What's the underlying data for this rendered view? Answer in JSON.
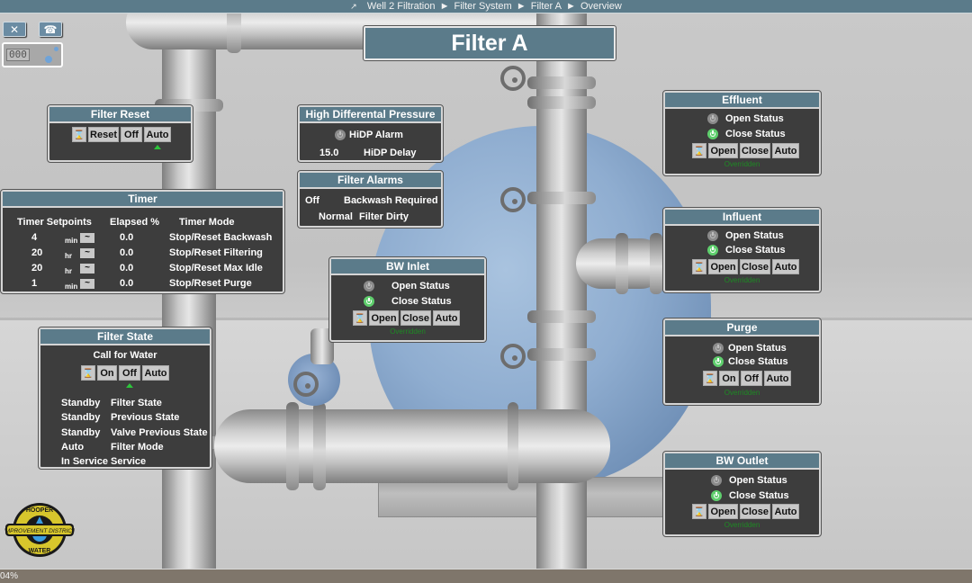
{
  "breadcrumb": {
    "icon": "↗",
    "items": [
      "Well 2 Filtration",
      "Filter System",
      "Filter A",
      "Overview"
    ],
    "separator": "►"
  },
  "toolbar": {
    "tool1_icon": "close-x-icon",
    "tool2_icon": "operator-icon",
    "counter_digits": "000"
  },
  "title": "Filter A",
  "filter_reset": {
    "title": "Filter Reset",
    "buttons": [
      "⌛",
      "Reset",
      "Off",
      "Auto"
    ],
    "selected": "Auto"
  },
  "high_dp": {
    "title": "High Differental Pressure",
    "alarm_label": "HiDP Alarm",
    "alarm_state": "off",
    "delay_value": "15.0",
    "delay_label": "HiDP Delay"
  },
  "filter_alarms": {
    "title": "Filter Alarms",
    "rows": [
      {
        "value": "Off",
        "label": "Backwash Required"
      },
      {
        "value": "Normal",
        "label": "Filter Dirty"
      }
    ]
  },
  "timer": {
    "title": "Timer",
    "headers": [
      "Timer Setpoints",
      "Elapsed %",
      "Timer Mode"
    ],
    "rows": [
      {
        "setpoint": "4",
        "unit": "min",
        "elapsed": "0.0",
        "mode": "Stop/Reset Backwash"
      },
      {
        "setpoint": "20",
        "unit": "hr",
        "elapsed": "0.0",
        "mode": "Stop/Reset Filtering"
      },
      {
        "setpoint": "20",
        "unit": "hr",
        "elapsed": "0.0",
        "mode": "Stop/Reset Max Idle"
      },
      {
        "setpoint": "1",
        "unit": "min",
        "elapsed": "0.0",
        "mode": "Stop/Reset Purge"
      }
    ],
    "edit_glyph": "~"
  },
  "filter_state": {
    "title": "Filter State",
    "subtitle": "Call for Water",
    "buttons": [
      "⌛",
      "On",
      "Off",
      "Auto"
    ],
    "selected": "Off",
    "rows": [
      {
        "value": "Standby",
        "label": "Filter State"
      },
      {
        "value": "Standby",
        "label": "Previous State"
      },
      {
        "value": "Standby",
        "label": "Valve Previous State"
      },
      {
        "value": "Auto",
        "label": "Filter Mode"
      },
      {
        "value": "In Service",
        "label": "Service"
      }
    ]
  },
  "valves": {
    "bw_inlet": {
      "title": "BW Inlet",
      "open_label": "Open Status",
      "close_label": "Close Status",
      "open_state": "off",
      "close_state": "on",
      "buttons": [
        "⌛",
        "Open",
        "Close",
        "Auto"
      ],
      "status": "Overridden"
    },
    "effluent": {
      "title": "Effluent",
      "open_label": "Open Status",
      "close_label": "Close Status",
      "open_state": "off",
      "close_state": "on",
      "buttons": [
        "⌛",
        "Open",
        "Close",
        "Auto"
      ],
      "status": "Overridden"
    },
    "influent": {
      "title": "Influent",
      "open_label": "Open Status",
      "close_label": "Close Status",
      "open_state": "off",
      "close_state": "on",
      "buttons": [
        "⌛",
        "Open",
        "Close",
        "Auto"
      ],
      "status": "Overridden"
    },
    "purge": {
      "title": "Purge",
      "open_label": "Open Status",
      "close_label": "Close Status",
      "open_state": "off",
      "close_state": "on",
      "buttons": [
        "⌛",
        "On",
        "Off",
        "Auto"
      ],
      "status": "Overridden"
    },
    "bw_outlet": {
      "title": "BW Outlet",
      "open_label": "Open Status",
      "close_label": "Close Status",
      "open_state": "off",
      "close_state": "on",
      "buttons": [
        "⌛",
        "Open",
        "Close",
        "Auto"
      ],
      "status": "Overridden"
    }
  },
  "logo": {
    "top": "HOOPER",
    "band": "IMPROVEMENT DISTRICT",
    "bottom": "WATER"
  },
  "footer": {
    "zoom": "04%"
  },
  "colors": {
    "header_blue": "#5b7b8a",
    "panel_bg": "#3d3d3d",
    "status_on": "#5fcf6d",
    "status_off": "#8b8b8b",
    "override_text": "#1e8a24"
  }
}
